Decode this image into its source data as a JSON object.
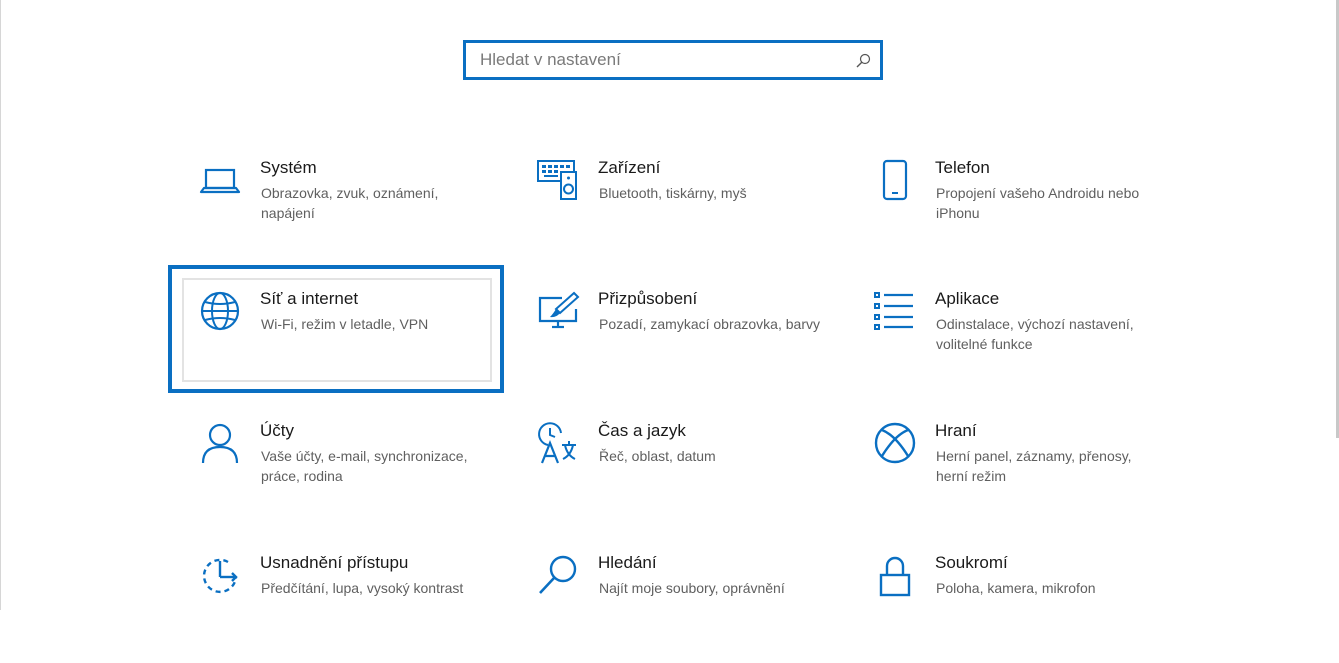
{
  "search": {
    "placeholder": "Hledat v nastavení",
    "value": ""
  },
  "accent_color": "#0a6fc2",
  "tiles": [
    {
      "title": "Systém",
      "desc": "Obrazovka, zvuk, oznámení, napájení",
      "icon": "laptop-icon"
    },
    {
      "title": "Zařízení",
      "desc": "Bluetooth, tiskárny, myš",
      "icon": "devices-icon"
    },
    {
      "title": "Telefon",
      "desc": "Propojení vašeho Androidu nebo iPhonu",
      "icon": "phone-icon"
    },
    {
      "title": "Síť a internet",
      "desc": "Wi-Fi, režim v letadle, VPN",
      "icon": "globe-icon",
      "focused": true
    },
    {
      "title": "Přizpůsobení",
      "desc": "Pozadí, zamykací obrazovka, barvy",
      "icon": "personalization-icon"
    },
    {
      "title": "Aplikace",
      "desc": "Odinstalace, výchozí nastavení, volitelné funkce",
      "icon": "apps-list-icon"
    },
    {
      "title": "Účty",
      "desc": "Vaše účty, e-mail, synchronizace, práce, rodina",
      "icon": "person-icon"
    },
    {
      "title": "Čas a jazyk",
      "desc": "Řeč, oblast, datum",
      "icon": "time-language-icon"
    },
    {
      "title": "Hraní",
      "desc": "Herní panel, záznamy, přenosy, herní režim",
      "icon": "xbox-icon"
    },
    {
      "title": "Usnadnění přístupu",
      "desc": "Předčítání, lupa, vysoký kontrast",
      "icon": "ease-of-access-icon"
    },
    {
      "title": "Hledání",
      "desc": "Najít moje soubory, oprávnění",
      "icon": "search-icon"
    },
    {
      "title": "Soukromí",
      "desc": "Poloha, kamera, mikrofon",
      "icon": "lock-icon"
    }
  ]
}
